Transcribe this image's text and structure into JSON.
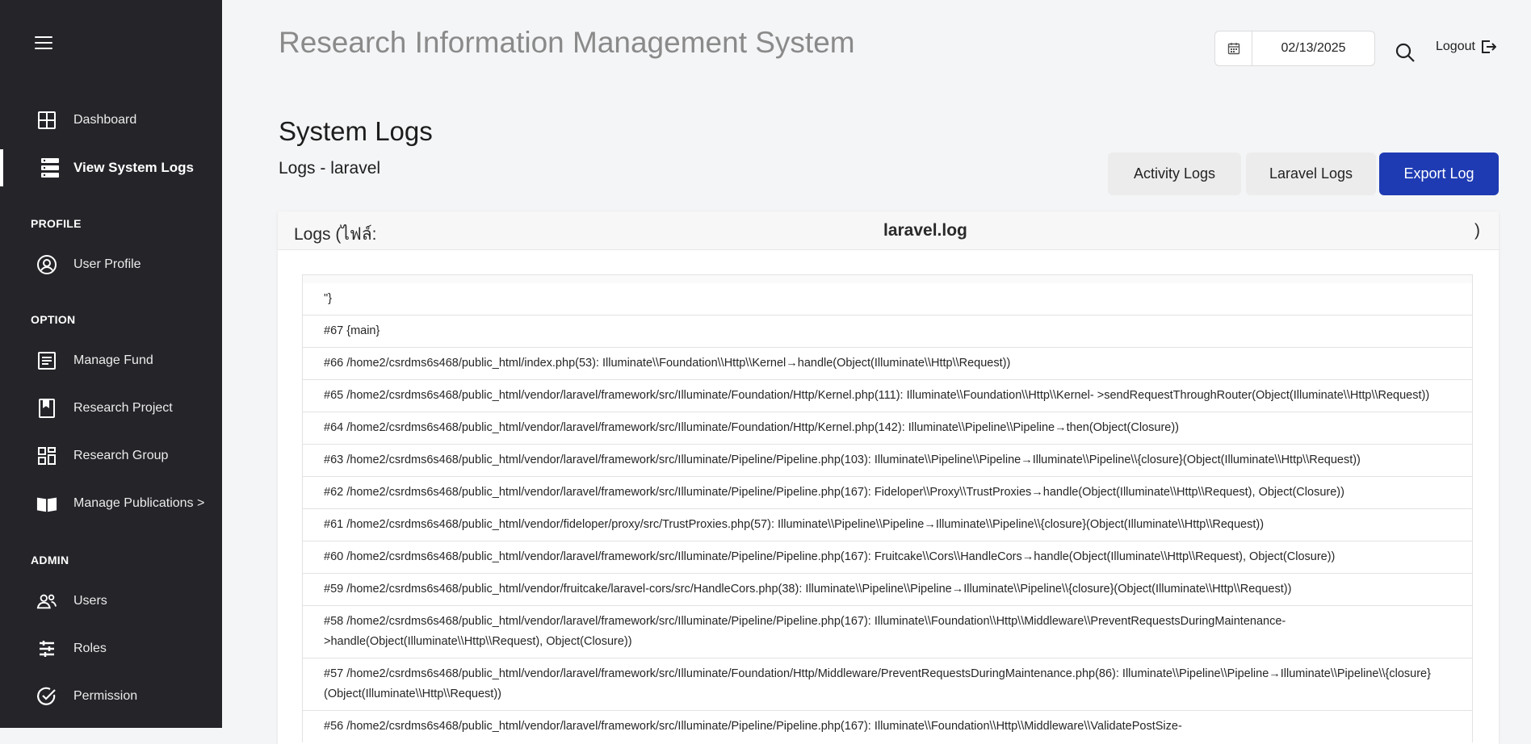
{
  "sidebar": {
    "items": [
      {
        "label": "Dashboard",
        "icon": "dashboard-grid-icon"
      },
      {
        "label": "View System Logs",
        "icon": "server-logs-icon",
        "active": true
      },
      {
        "label": "User Profile",
        "icon": "user-circle-icon"
      },
      {
        "label": "Manage Fund",
        "icon": "document-list-icon"
      },
      {
        "label": "Research Project",
        "icon": "book-icon"
      },
      {
        "label": "Research Group",
        "icon": "group-grid-icon"
      },
      {
        "label": "Manage Publications >",
        "icon": "open-book-icon"
      },
      {
        "label": "Users",
        "icon": "users-icon"
      },
      {
        "label": "Roles",
        "icon": "roles-icon"
      },
      {
        "label": "Permission",
        "icon": "check-circle-icon"
      }
    ],
    "sections": {
      "profile": "PROFILE",
      "option": "OPTION",
      "admin": "ADMIN"
    }
  },
  "header": {
    "app_title": "Research Information Management System",
    "date_value": "02/13/2025",
    "logout_label": "Logout"
  },
  "page": {
    "title": "System Logs",
    "subtitle": "Logs - laravel",
    "buttons": {
      "activity": "Activity Logs",
      "laravel": "Laravel Logs",
      "export": "Export Log"
    }
  },
  "card": {
    "head_prefix": "Logs (ไฟล์:",
    "file_name": "laravel.log",
    "head_suffix": ")"
  },
  "logs": [
    "\"}",
    "#67 {main}",
    "#66 /home2/csrdms6s468/public_html/index.php(53): Illuminate\\\\Foundation\\\\Http\\\\Kernel→handle(Object(Illuminate\\\\Http\\\\Request))",
    "#65 /home2/csrdms6s468/public_html/vendor/laravel/framework/src/Illuminate/Foundation/Http/Kernel.php(111): Illuminate\\\\Foundation\\\\Http\\\\Kernel- >sendRequestThroughRouter(Object(Illuminate\\\\Http\\\\Request))",
    "#64 /home2/csrdms6s468/public_html/vendor/laravel/framework/src/Illuminate/Foundation/Http/Kernel.php(142): Illuminate\\\\Pipeline\\\\Pipeline→then(Object(Closure))",
    "#63 /home2/csrdms6s468/public_html/vendor/laravel/framework/src/Illuminate/Pipeline/Pipeline.php(103): Illuminate\\\\Pipeline\\\\Pipeline→Illuminate\\\\Pipeline\\\\{closure}(Object(Illuminate\\\\Http\\\\Request))",
    "#62 /home2/csrdms6s468/public_html/vendor/laravel/framework/src/Illuminate/Pipeline/Pipeline.php(167): Fideloper\\\\Proxy\\\\TrustProxies→handle(Object(Illuminate\\\\Http\\\\Request), Object(Closure))",
    "#61 /home2/csrdms6s468/public_html/vendor/fideloper/proxy/src/TrustProxies.php(57): Illuminate\\\\Pipeline\\\\Pipeline→Illuminate\\\\Pipeline\\\\{closure}(Object(Illuminate\\\\Http\\\\Request))",
    "#60 /home2/csrdms6s468/public_html/vendor/laravel/framework/src/Illuminate/Pipeline/Pipeline.php(167): Fruitcake\\\\Cors\\\\HandleCors→handle(Object(Illuminate\\\\Http\\\\Request), Object(Closure))",
    "#59 /home2/csrdms6s468/public_html/vendor/fruitcake/laravel-cors/src/HandleCors.php(38): Illuminate\\\\Pipeline\\\\Pipeline→Illuminate\\\\Pipeline\\\\{closure}(Object(Illuminate\\\\Http\\\\Request))",
    "#58 /home2/csrdms6s468/public_html/vendor/laravel/framework/src/Illuminate/Pipeline/Pipeline.php(167): Illuminate\\\\Foundation\\\\Http\\\\Middleware\\\\PreventRequestsDuringMaintenance- >handle(Object(Illuminate\\\\Http\\\\Request), Object(Closure))",
    "#57 /home2/csrdms6s468/public_html/vendor/laravel/framework/src/Illuminate/Foundation/Http/Middleware/PreventRequestsDuringMaintenance.php(86): Illuminate\\\\Pipeline\\\\Pipeline→Illuminate\\\\Pipeline\\\\{closure}(Object(Illuminate\\\\Http\\\\Request))",
    "#56 /home2/csrdms6s468/public_html/vendor/laravel/framework/src/Illuminate/Pipeline/Pipeline.php(167): Illuminate\\\\Foundation\\\\Http\\\\Middleware\\\\ValidatePostSize-"
  ],
  "colors": {
    "sidebar_bg": "#242429",
    "accent": "#1e3bb3"
  }
}
